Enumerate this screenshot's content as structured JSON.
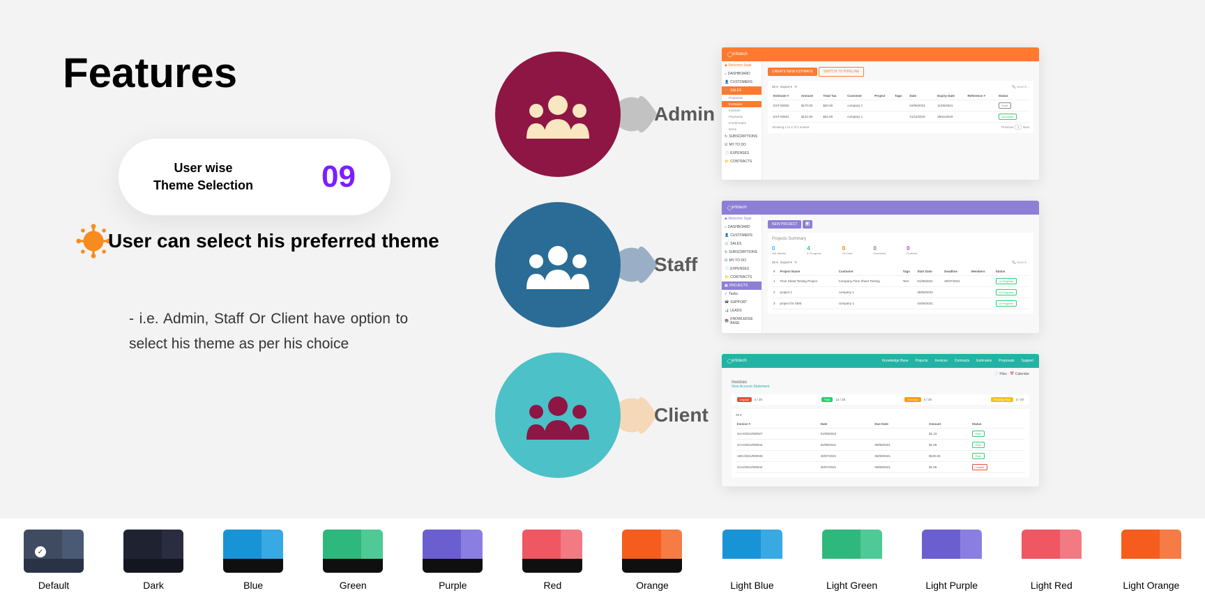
{
  "heading": "Features",
  "pill": {
    "line1": "User wise",
    "line2": "Theme Selection",
    "number": "09"
  },
  "subtitle": "User can select his preferred theme",
  "description": " - i.e. Admin, Staff Or Client have option to select his theme as per his choice",
  "roles": [
    {
      "label": "Admin",
      "color": "#8e1644",
      "iconFill": "#f8e7c0",
      "arrow": "#c2c2c2"
    },
    {
      "label": "Staff",
      "color": "#2a6c95",
      "iconFill": "#ffffff",
      "arrow": "#9aafc5"
    },
    {
      "label": "Client",
      "color": "#4cc1c7",
      "iconFill": "#8e1644",
      "arrow": "#f4d8b8"
    }
  ],
  "shots": {
    "admin": {
      "accent": "#ff7a2e",
      "brand": "infotech",
      "sidebar": [
        "DASHBOARD",
        "CUSTOMERS",
        "SALES",
        "SUBSCRIPTIONS",
        "MY TO DO",
        "EXPENSES",
        "CONTRACTS"
      ],
      "salesSub": [
        "Proposals",
        "Estimates",
        "Invoices",
        "Payments",
        "Credit Notes",
        "Items"
      ],
      "btnPrimary": "CREATE NEW ESTIMATE",
      "btnSecondary": "SWITCH TO PIPELINE",
      "searchPlaceholder": "Search...",
      "perPage": "25",
      "export": "Export",
      "tableHead": [
        "Estimate #",
        "Amount",
        "Total Tax",
        "Customer",
        "Project",
        "Tags",
        "Date",
        "Expiry Date",
        "Reference #",
        "Status"
      ],
      "rows": [
        [
          "EST-00002",
          "$170.00",
          "$20.00",
          "company 1",
          "",
          "",
          "04/06/2021",
          "11/06/2021",
          "",
          "Draft"
        ],
        [
          "EST-00001",
          "$122.00",
          "$22.00",
          "company 1",
          "",
          "",
          "21/11/2019",
          "28/11/2019",
          "",
          "Accepted"
        ]
      ],
      "footer": "Showing 1 to 2 of 2 entries",
      "pagination": [
        "Previous",
        "1",
        "Next"
      ]
    },
    "staff": {
      "accent": "#8d7fd6",
      "brand": "infotech",
      "sidebar": [
        "DASHBOARD",
        "CUSTOMERS",
        "SALES",
        "SUBSCRIPTIONS",
        "MY TO DO",
        "EXPENSES",
        "CONTRACTS",
        "PROJECTS",
        "Tasks",
        "SUPPORT",
        "LEADS",
        "KNOWLEDGE BASE"
      ],
      "btn": "NEW PROJECT",
      "summaryTitle": "Projects Summary",
      "summary": [
        {
          "n": "0",
          "l": "Not Started",
          "c": "#4aa9ff"
        },
        {
          "n": "4",
          "l": "In Progress",
          "c": "#2ecc71"
        },
        {
          "n": "0",
          "l": "On Hold",
          "c": "#e67e22"
        },
        {
          "n": "0",
          "l": "Cancelled",
          "c": "#888"
        },
        {
          "n": "0",
          "l": "Finished",
          "c": "#9b59b6"
        }
      ],
      "perPage": "25",
      "export": "Export",
      "searchPlaceholder": "Search...",
      "tableHead": [
        "#",
        "Project Name",
        "Customer",
        "Tags",
        "Start Date",
        "Deadline",
        "Members",
        "Status"
      ],
      "rows": [
        [
          "1",
          "Time Sheet Testing Project",
          "Company-Time Sheet Testing",
          "Test",
          "01/08/2021",
          "30/07/2021",
          "",
          "In Progress"
        ],
        [
          "2",
          "project 1",
          "company 1",
          "",
          "28/08/2020",
          "",
          "",
          "In Progress"
        ],
        [
          "3",
          "project for SMS",
          "company 1",
          "",
          "24/06/2021",
          "",
          "",
          "In Progress"
        ]
      ]
    },
    "client": {
      "accent": "#22b3a4",
      "brand": "infotech",
      "headerNav": [
        "Knowledge Base",
        "Projects",
        "Invoices",
        "Contracts",
        "Estimates",
        "Proposals",
        "Support"
      ],
      "tabs": [
        "Files",
        "Calendar"
      ],
      "heading": "Invoices",
      "subheading": "View Account Statement",
      "statusBar": [
        {
          "l": "Unpaid",
          "v": "4 / 20",
          "c": "#e74c3c"
        },
        {
          "l": "Paid",
          "v": "14 / 20",
          "c": "#2ecc71"
        },
        {
          "l": "Overdue",
          "v": "4 / 20",
          "c": "#f39c12"
        },
        {
          "l": "Partially Paid",
          "v": "2 / 20",
          "c": "#f1c40f"
        }
      ],
      "perPage": "25",
      "tableHead": [
        "Invoice #",
        "Date",
        "Due Date",
        "Amount",
        "Status"
      ],
      "rows": [
        [
          "SAA/2021/000027",
          "01/09/2022",
          "",
          "$1.23",
          "Paid"
        ],
        [
          "SAA/2021/000044",
          "02/08/2021",
          "09/08/2021",
          "$1.05",
          "Paid"
        ],
        [
          "ABC/2021/000046",
          "30/07/2021",
          "06/08/2021",
          "$100.00",
          "Paid"
        ],
        [
          "SAA/2021/000044",
          "30/07/2021",
          "09/08/2021",
          "$1.05",
          "Unpaid"
        ]
      ]
    }
  },
  "themes": [
    {
      "label": "Default",
      "left": "#3f4b60",
      "right": "#4b5a74",
      "bottom": "#2a3245",
      "check": true
    },
    {
      "label": "Dark",
      "left": "#1f2231",
      "right": "#2a2d40",
      "bottom": "#14161f"
    },
    {
      "label": "Blue",
      "left": "#1894d6",
      "right": "#38a9e3",
      "bottom": "#0f0f0f"
    },
    {
      "label": "Green",
      "left": "#2fb87e",
      "right": "#4fc996",
      "bottom": "#0f0f0f"
    },
    {
      "label": "Purple",
      "left": "#6b5fd0",
      "right": "#8a7fe0",
      "bottom": "#0f0f0f"
    },
    {
      "label": "Red",
      "left": "#ef5762",
      "right": "#f27a82",
      "bottom": "#0f0f0f"
    },
    {
      "label": "Orange",
      "left": "#f45d1e",
      "right": "#f57c45",
      "bottom": "#0f0f0f"
    },
    {
      "label": "Light Blue",
      "left": "#1894d6",
      "right": "#38a9e3",
      "bottom": "#ffffff"
    },
    {
      "label": "Light Green",
      "left": "#2fb87e",
      "right": "#4fc996",
      "bottom": "#ffffff"
    },
    {
      "label": "Light Purple",
      "left": "#6b5fd0",
      "right": "#8a7fe0",
      "bottom": "#ffffff"
    },
    {
      "label": "Light Red",
      "left": "#ef5762",
      "right": "#f27a82",
      "bottom": "#ffffff"
    },
    {
      "label": "Light Orange",
      "left": "#f45d1e",
      "right": "#f57c45",
      "bottom": "#ffffff"
    }
  ]
}
